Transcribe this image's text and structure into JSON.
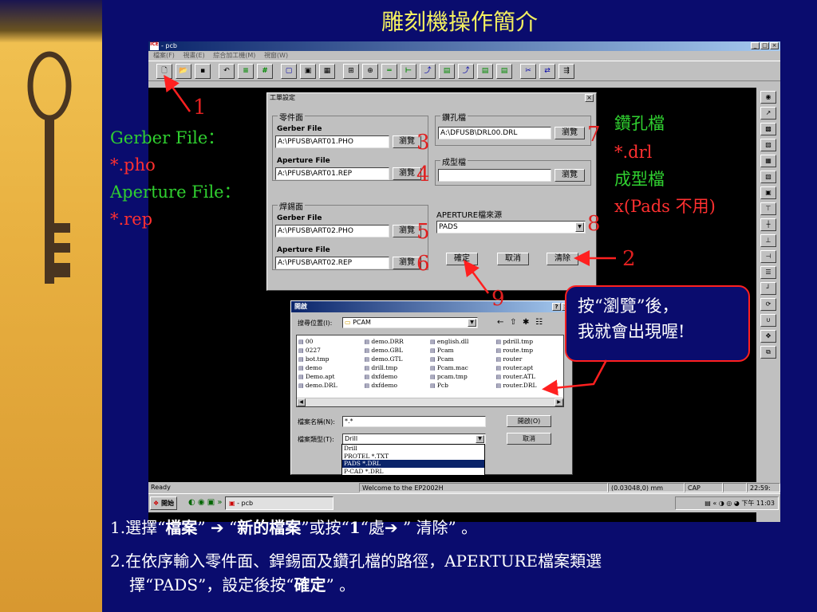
{
  "slide": {
    "title": "雕刻機操作簡介",
    "left_notes": [
      "Gerber File：",
      "*.pho",
      "Aperture File：",
      "*.rep"
    ],
    "right_notes": [
      "鑽孔檔",
      "*.drl",
      "成型檔",
      "x(Pads 不用)"
    ],
    "bubble_lines": [
      "按“瀏覽”後，",
      "我就會出現喔!"
    ],
    "numbers": [
      "1",
      "2",
      "3",
      "4",
      "5",
      "6",
      "7",
      "8",
      "9"
    ],
    "bottom": {
      "line1_parts": [
        "1.選擇“",
        "檔案",
        "” ➔ “",
        "新的檔案",
        "”或按“",
        "1",
        "“處➔ ” 清除” 。"
      ],
      "line2_parts": [
        "2.在依序輸入零件面、銲錫面及鑽孔檔的路徑，APERTURE檔案類選",
        "擇“PADS”，設定後按“",
        "確定",
        "” 。"
      ]
    }
  },
  "app": {
    "title": "- pcb",
    "icon_label": "ICE",
    "menu": [
      "檔案(F)",
      "視畫(E)",
      "綜合加工機(M)",
      "視窗(W)"
    ],
    "status": {
      "ready": "Ready",
      "welcome": "Welcome to the EP2002H",
      "coords": "(0.03048,0) mm",
      "cap": "CAP",
      "time_short": "22:59:"
    },
    "taskbar": {
      "start": "開始",
      "task": "- pcb",
      "tray_time": "下午 11:03"
    }
  },
  "setup_dialog": {
    "title": "工單設定",
    "component_group": "零件面",
    "solder_group": "焊錫面",
    "drill_group": "鑽孔檔",
    "routing_group": "成型檔",
    "aperture_group": "APERTURE檔來源",
    "gerber_label": "Gerber File",
    "aperture_label": "Aperture File",
    "component_gerber": "A:\\PFUSB\\ART01.PHO",
    "component_aperture": "A:\\PFUSB\\ART01.REP",
    "solder_gerber": "A:\\PFUSB\\ART02.PHO",
    "solder_aperture": "A:\\PFUSB\\ART02.REP",
    "drill_path": "A:\\DFUSB\\DRL00.DRL",
    "routing_path": "",
    "aperture_source": "PADS",
    "browse": "瀏覽",
    "ok": "確定",
    "cancel": "取消",
    "clear": "清除"
  },
  "open_dialog": {
    "title": "開啟",
    "look_in_label": "搜尋位置(I):",
    "look_in": "PCAM",
    "files_col1": [
      "00",
      "0227",
      "bot.tmp",
      "demo",
      "Demo.apt",
      "demo.DRL"
    ],
    "files_col2": [
      "demo.DRR",
      "demo.GBL",
      "demo.GTL",
      "drill.tmp",
      "dxfdemo",
      "dxfdemo"
    ],
    "files_col3": [
      "english.dll",
      "Pcam",
      "Pcam",
      "Pcam.mac",
      "pcam.tmp",
      "Pcb"
    ],
    "files_col4": [
      "pdrill.tmp",
      "route.tmp",
      "router",
      "router.apt",
      "router.ATL",
      "router.DRL"
    ],
    "filename_label": "檔案名稱(N):",
    "filename": "*.*",
    "filetype_label": "檔案類型(T):",
    "filetype": "Drill",
    "filetype_options": [
      "Drill",
      "PROTEL *.TXT",
      "PADS *.DRL",
      "P-CAD *.DRL"
    ],
    "open_button": "開啟(O)",
    "cancel_button": "取消"
  },
  "colors": {
    "background": "#0a0c6e",
    "title": "#f4f060",
    "left_label": "#30d030",
    "left_ext": "#ff3030",
    "right_label": "#30d030",
    "right_ext": "#ff3030",
    "callout": "#e02020"
  }
}
